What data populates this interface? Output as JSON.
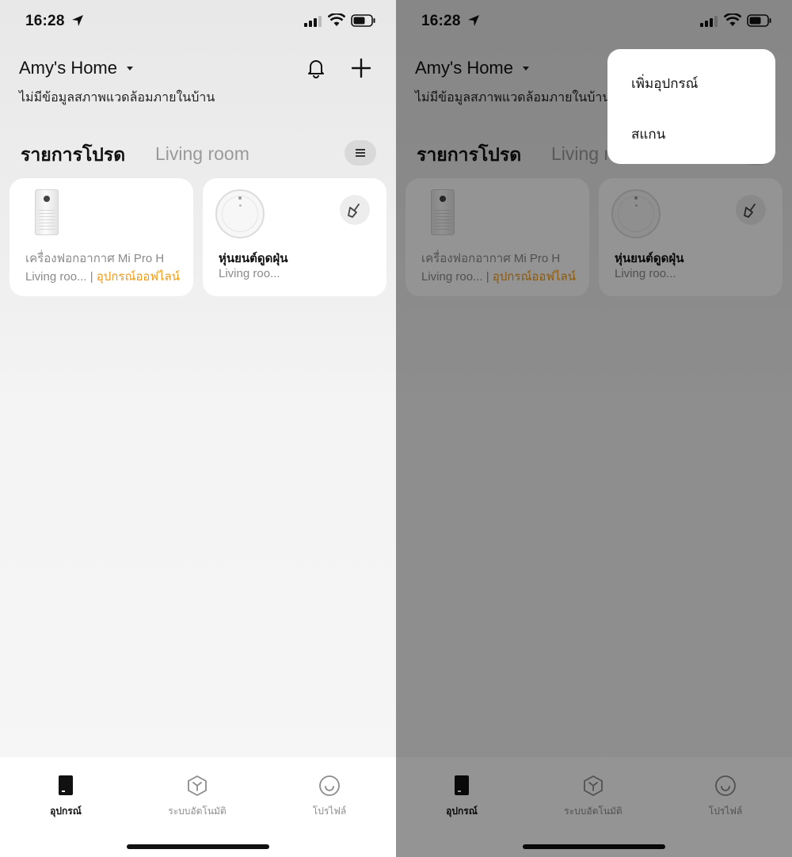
{
  "status_bar": {
    "time": "16:28"
  },
  "header": {
    "home_name": "Amy's Home",
    "env_status": "ไม่มีข้อมูลสภาพแวดล้อมภายในบ้าน"
  },
  "tabs": {
    "favorites": "รายการโปรด",
    "living_room": "Living room"
  },
  "devices": [
    {
      "name": "เครื่องฟอกอากาศ Mi Pro H",
      "room": "Living roo...",
      "separator": " | ",
      "status": "อุปกรณ์ออฟไลน์",
      "status_color": "#f09a1a"
    },
    {
      "name": "หุ่นยนต์ดูดฝุ่น",
      "room": "Living roo..."
    }
  ],
  "tabbar": {
    "devices": "อุปกรณ์",
    "automation": "ระบบอัตโนมัติ",
    "profile": "โปรไฟล์"
  },
  "popup_menu": {
    "add_device": "เพิ่มอุปกรณ์",
    "scan": "สแกน"
  },
  "colors": {
    "accent_offline": "#f09a1a",
    "overlay": "rgba(0,0,0,0.42)"
  }
}
